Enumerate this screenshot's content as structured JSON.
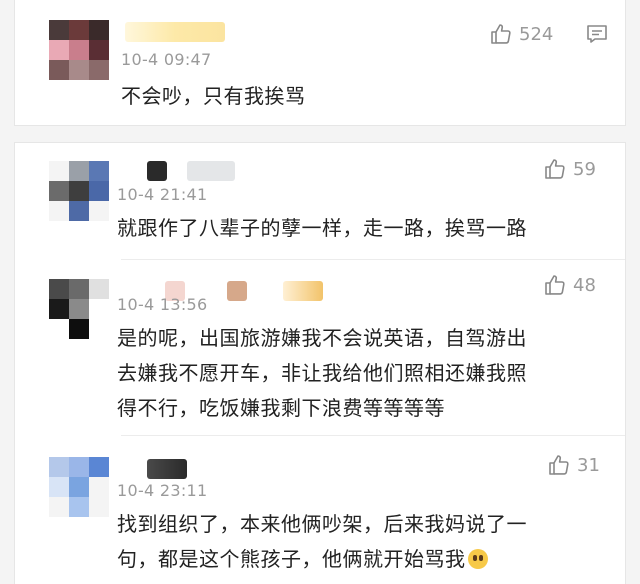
{
  "comments": [
    {
      "time": "10-4 09:47",
      "likes": "524",
      "text": "不会吵，只有我挨骂"
    },
    {
      "time": "10-4 21:41",
      "likes": "59",
      "text": "就跟作了八辈子的孽一样，走一路，挨骂一路"
    },
    {
      "time": "10-4 13:56",
      "likes": "48",
      "lines": [
        "是的呢，出国旅游嫌我不会说英语，自驾游出",
        "去嫌我不愿开车，非让我给他们照相还嫌我照",
        "得不行，吃饭嫌我剩下浪费等等等等"
      ]
    },
    {
      "time": "10-4 23:11",
      "likes": "31",
      "lines": [
        "找到组织了，本来他俩吵架，后来我妈说了一",
        "句，都是这个熊孩子，他俩就开始骂我"
      ]
    }
  ],
  "icons": {
    "like": "thumbs-up-icon",
    "comment": "comment-icon",
    "emoji": "crying-laughing-emoji-icon"
  },
  "colors": {
    "text": "#222222",
    "meta": "#9a9a9a",
    "background": "#f4f4f4"
  }
}
